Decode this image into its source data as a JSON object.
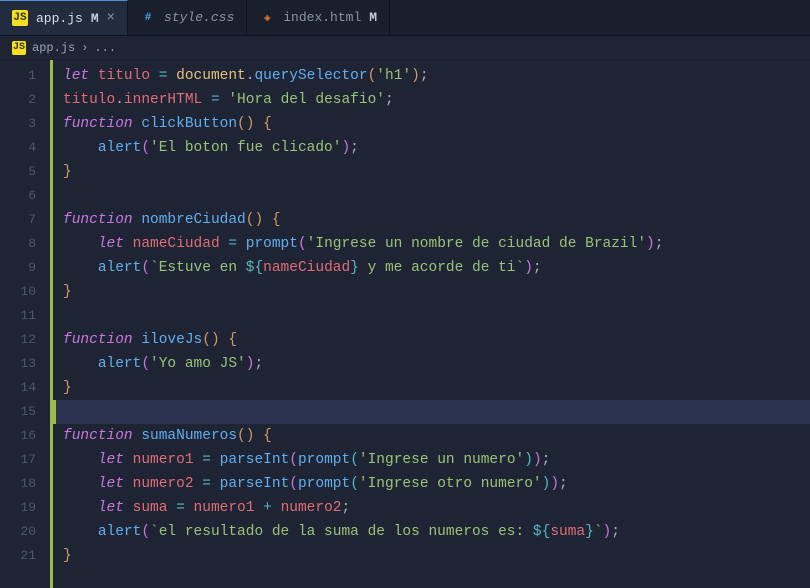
{
  "tabs": [
    {
      "icon": "JS",
      "iconClass": "icon-js",
      "label": "app.js",
      "dirty": "M",
      "close": "×",
      "active": true,
      "italic": false
    },
    {
      "icon": "#",
      "iconClass": "icon-css",
      "label": "style.css",
      "dirty": "",
      "close": "",
      "active": false,
      "italic": true
    },
    {
      "icon": "◈",
      "iconClass": "icon-html",
      "label": "index.html",
      "dirty": "M",
      "close": "",
      "active": false,
      "italic": false
    }
  ],
  "breadcrumb": {
    "icon": "JS",
    "file": "app.js",
    "sep": "›",
    "rest": "..."
  },
  "code": {
    "l1": {
      "a": "let ",
      "b": "titulo",
      "c": " = ",
      "d": "document",
      "e": ".",
      "f": "querySelector",
      "g": "(",
      "h": "'h1'",
      "i": ")",
      "j": ";"
    },
    "l2": {
      "a": "titulo",
      "b": ".",
      "c": "innerHTML",
      "d": " = ",
      "e": "'Hora del desafio'",
      "f": ";"
    },
    "l3": {
      "a": "function ",
      "b": "clickButton",
      "c": "()",
      "d": " {",
      "e": ""
    },
    "l4": {
      "ind": "    ",
      "a": "alert",
      "b": "(",
      "c": "'El boton fue clicado'",
      "d": ")",
      "e": ";"
    },
    "l5": {
      "a": "}"
    },
    "l7": {
      "a": "function ",
      "b": "nombreCiudad",
      "c": "()",
      "d": " {"
    },
    "l8": {
      "ind": "    ",
      "a": "let ",
      "b": "nameCiudad",
      "c": " = ",
      "d": "prompt",
      "e": "(",
      "f": "'Ingrese un nombre de ciudad de Brazil'",
      "g": ")",
      "h": ";"
    },
    "l9": {
      "ind": "    ",
      "a": "alert",
      "b": "(",
      "c": "`Estuve en ",
      "d": "${",
      "e": "nameCiudad",
      "f": "}",
      "g": " y me acorde de ti`",
      "h": ")",
      "i": ";"
    },
    "l10": {
      "a": "}"
    },
    "l12": {
      "a": "function ",
      "b": "iloveJs",
      "c": "()",
      "d": " {"
    },
    "l13": {
      "ind": "    ",
      "a": "alert",
      "b": "(",
      "c": "'Yo amo JS'",
      "d": ")",
      "e": ";"
    },
    "l14": {
      "a": "}"
    },
    "l16": {
      "a": "function ",
      "b": "sumaNumeros",
      "c": "()",
      "d": " {"
    },
    "l17": {
      "ind": "    ",
      "a": "let ",
      "b": "numero1",
      "c": " = ",
      "d": "parseInt",
      "e": "(",
      "f": "prompt",
      "g": "(",
      "h": "'Ingrese un numero'",
      "i": ")",
      "j": ")",
      "k": ";"
    },
    "l18": {
      "ind": "    ",
      "a": "let ",
      "b": "numero2",
      "c": " = ",
      "d": "parseInt",
      "e": "(",
      "f": "prompt",
      "g": "(",
      "h": "'Ingrese otro numero'",
      "i": ")",
      "j": ")",
      "k": ";"
    },
    "l19": {
      "ind": "    ",
      "a": "let ",
      "b": "suma",
      "c": " = ",
      "d": "numero1",
      "e": " + ",
      "f": "numero2",
      "g": ";"
    },
    "l20": {
      "ind": "    ",
      "a": "alert",
      "b": "(",
      "c": "`el resultado de la suma de los numeros es: ",
      "d": "${",
      "e": "suma",
      "f": "}",
      "g": "`",
      "h": ")",
      "i": ";"
    },
    "l21": {
      "a": "}"
    }
  },
  "lineNumbers": [
    "1",
    "2",
    "3",
    "4",
    "5",
    "6",
    "7",
    "8",
    "9",
    "10",
    "11",
    "12",
    "13",
    "14",
    "15",
    "16",
    "17",
    "18",
    "19",
    "20",
    "21"
  ]
}
